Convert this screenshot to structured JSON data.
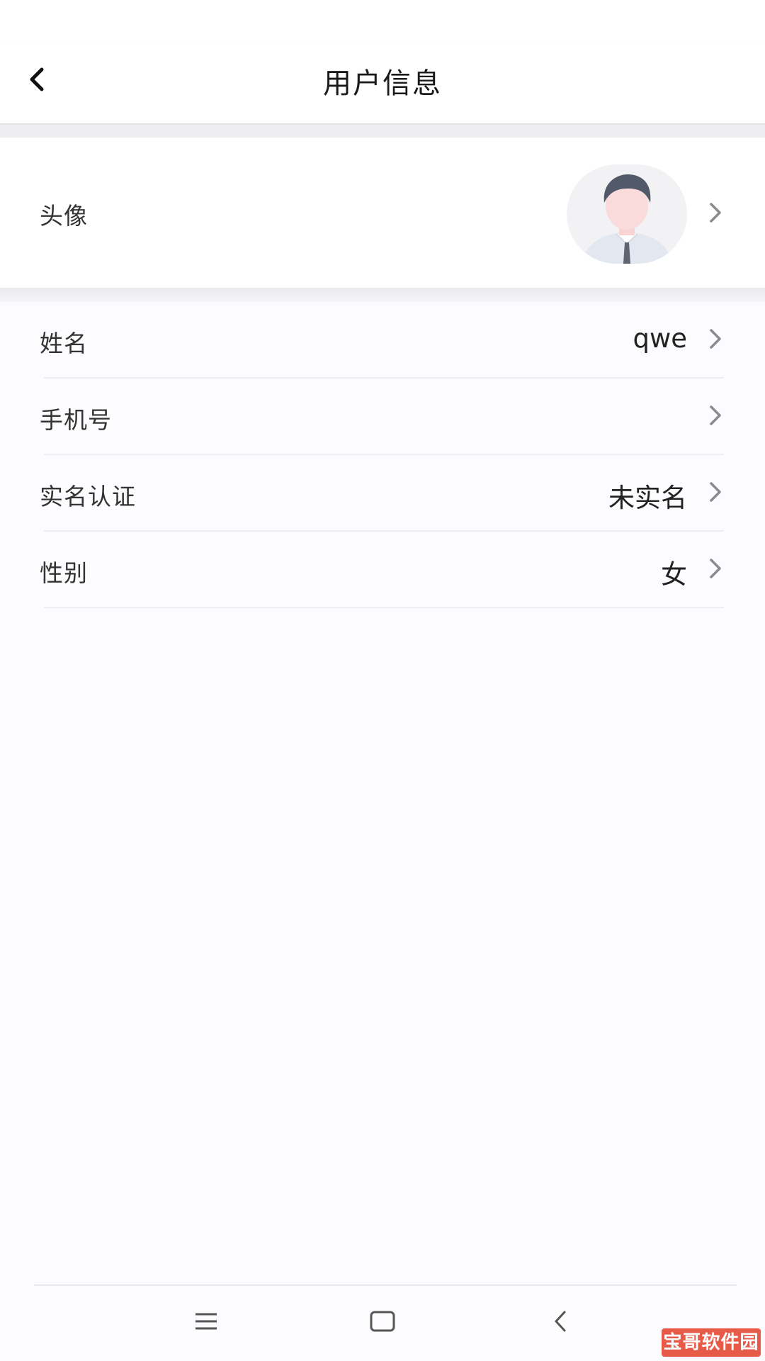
{
  "header": {
    "title": "用户信息",
    "back_icon": "chevron-left-icon"
  },
  "profile": {
    "avatar_label": "头像",
    "rows": [
      {
        "key": "name",
        "label": "姓名",
        "value": "qwe"
      },
      {
        "key": "phone",
        "label": "手机号",
        "value": ""
      },
      {
        "key": "real-name-verification",
        "label": "实名认证",
        "value": "未实名"
      },
      {
        "key": "gender",
        "label": "性别",
        "value": "女"
      }
    ]
  },
  "nav": {
    "menu_icon": "menu-icon",
    "home_icon": "home-square-icon",
    "back_icon": "back-triangle-icon"
  },
  "watermark": {
    "text": "宝哥软件园"
  },
  "colors": {
    "background": "#fcfbfd",
    "header_bg": "#ffffff",
    "section_gap": "#eeedf0",
    "text_primary": "#333333",
    "chevron": "#8a8a8f",
    "watermark_bg": "#e85a48"
  }
}
